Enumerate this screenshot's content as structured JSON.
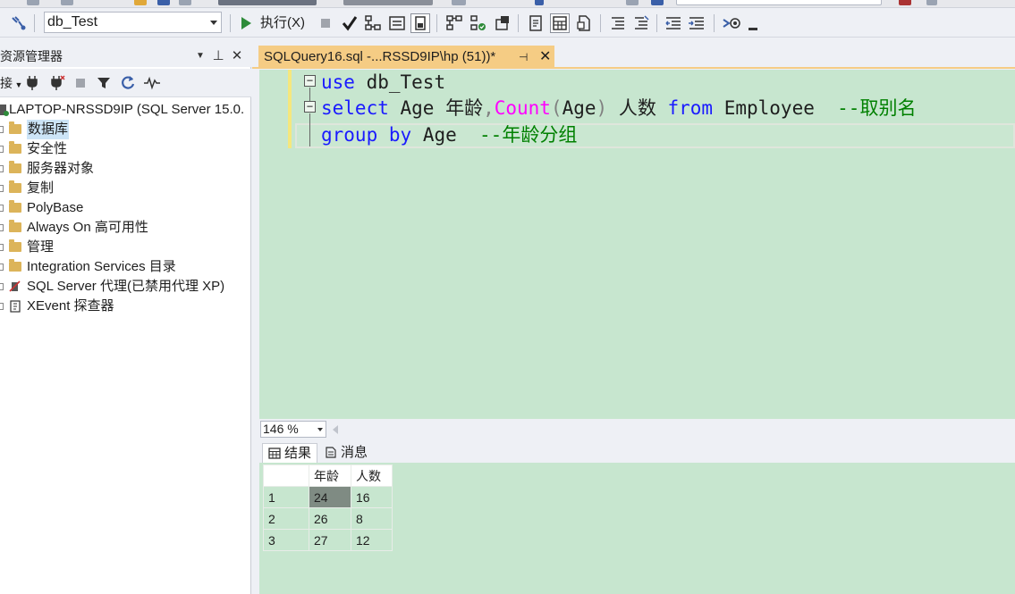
{
  "toolbar": {
    "database": "db_Test",
    "execute_label": "执行(X)"
  },
  "object_explorer": {
    "title": "资源管理器",
    "connect_label": "接",
    "server_node": "LAPTOP-NRSSD9IP (SQL Server 15.0.",
    "nodes": [
      {
        "label": "数据库",
        "icon": "folder-icon"
      },
      {
        "label": "安全性",
        "icon": "folder-icon"
      },
      {
        "label": "服务器对象",
        "icon": "folder-icon"
      },
      {
        "label": "复制",
        "icon": "folder-icon"
      },
      {
        "label": "PolyBase",
        "icon": "folder-icon"
      },
      {
        "label": "Always On 高可用性",
        "icon": "folder-icon"
      },
      {
        "label": "管理",
        "icon": "folder-icon"
      },
      {
        "label": "Integration Services 目录",
        "icon": "folder-icon"
      },
      {
        "label": "SQL Server 代理(已禁用代理 XP)",
        "icon": "agent-icon"
      },
      {
        "label": "XEvent 探查器",
        "icon": "xevent-icon"
      }
    ]
  },
  "document_tab": {
    "title": "SQLQuery16.sql -...RSSD9IP\\hp (51))*"
  },
  "editor": {
    "lines": [
      [
        {
          "t": "use",
          "c": "kw"
        },
        {
          "t": " db_Test",
          "c": "pl"
        }
      ],
      [
        {
          "t": "select",
          "c": "kw"
        },
        {
          "t": " Age 年龄",
          "c": "pl"
        },
        {
          "t": ",",
          "c": "gr"
        },
        {
          "t": "Count",
          "c": "fn"
        },
        {
          "t": "(",
          "c": "gr"
        },
        {
          "t": "Age",
          "c": "pl"
        },
        {
          "t": ")",
          "c": "gr"
        },
        {
          "t": " 人数 ",
          "c": "pl"
        },
        {
          "t": "from",
          "c": "kw"
        },
        {
          "t": " Employee  ",
          "c": "pl"
        },
        {
          "t": "--取别名",
          "c": "cm"
        }
      ],
      [
        {
          "t": "group",
          "c": "kw"
        },
        {
          "t": " ",
          "c": "pl"
        },
        {
          "t": "by",
          "c": "kw"
        },
        {
          "t": " Age  ",
          "c": "pl"
        },
        {
          "t": "--年龄分组",
          "c": "cm"
        }
      ]
    ]
  },
  "zoom": "146 %",
  "results": {
    "tabs": [
      "结果",
      "消息"
    ],
    "columns": [
      "年龄",
      "人数"
    ],
    "rows": [
      {
        "num": "1",
        "cells": [
          "24",
          "16"
        ]
      },
      {
        "num": "2",
        "cells": [
          "26",
          "8"
        ]
      },
      {
        "num": "3",
        "cells": [
          "27",
          "12"
        ]
      }
    ]
  }
}
